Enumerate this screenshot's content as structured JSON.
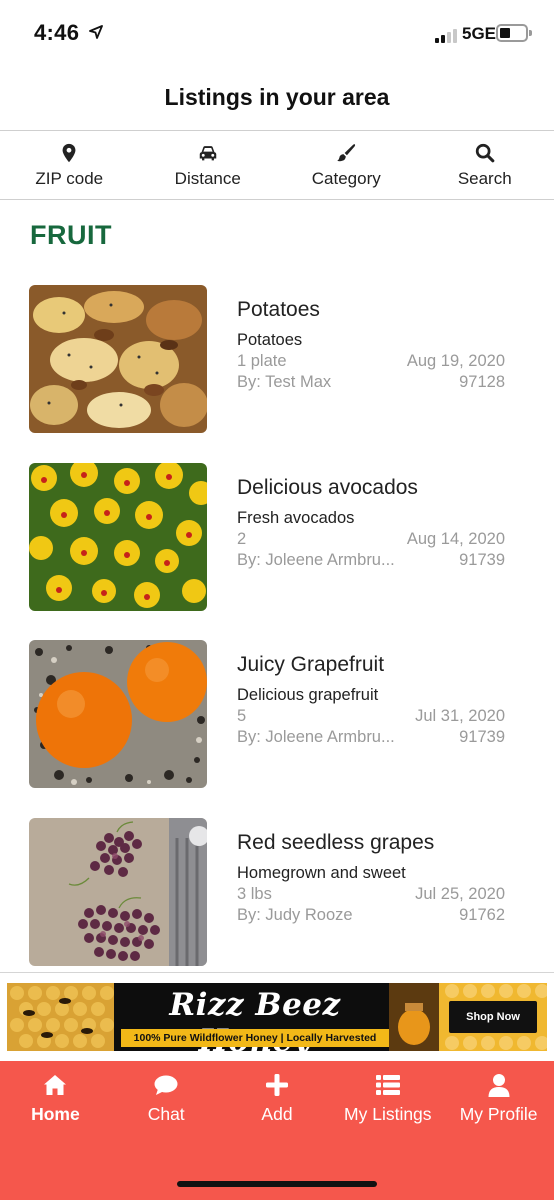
{
  "status_bar": {
    "time": "4:46",
    "network": "5GE"
  },
  "header": {
    "title": "Listings in your area"
  },
  "filters": [
    {
      "label": "ZIP code",
      "icon": "map-pin-icon"
    },
    {
      "label": "Distance",
      "icon": "car-icon"
    },
    {
      "label": "Category",
      "icon": "paintbrush-icon"
    },
    {
      "label": "Search",
      "icon": "search-icon"
    }
  ],
  "section": {
    "title": "FRUIT"
  },
  "listings": [
    {
      "title": "Potatoes",
      "description": "Potatoes",
      "quantity": "1 plate",
      "date": "Aug 19, 2020",
      "author": "By: Test Max",
      "zip": "97128"
    },
    {
      "title": "Delicious avocados",
      "description": "Fresh avocados",
      "quantity": "2",
      "date": "Aug 14, 2020",
      "author": "By: Joleene Armbru...",
      "zip": "91739"
    },
    {
      "title": "Juicy Grapefruit",
      "description": "Delicious grapefruit",
      "quantity": "5",
      "date": "Jul 31, 2020",
      "author": "By: Joleene Armbru...",
      "zip": "91739"
    },
    {
      "title": "Red seedless grapes",
      "description": "Homegrown and sweet",
      "quantity": "3 lbs",
      "date": "Jul 25, 2020",
      "author": "By: Judy Rooze",
      "zip": "91762"
    }
  ],
  "ad": {
    "brand": "Rizz Beez Honey",
    "tagline": "100% Pure Wildflower Honey  |  Locally Harvested",
    "cta": "Shop Now"
  },
  "tabs": [
    {
      "label": "Home",
      "icon": "home-icon",
      "active": true
    },
    {
      "label": "Chat",
      "icon": "chat-bubble-icon",
      "active": false
    },
    {
      "label": "Add",
      "icon": "plus-icon",
      "active": false
    },
    {
      "label": "My Listings",
      "icon": "list-icon",
      "active": false
    },
    {
      "label": "My Profile",
      "icon": "user-icon",
      "active": false
    }
  ],
  "colors": {
    "accent": "#f5574c",
    "section_title": "#17683d",
    "muted_text": "#9a9a9a"
  }
}
